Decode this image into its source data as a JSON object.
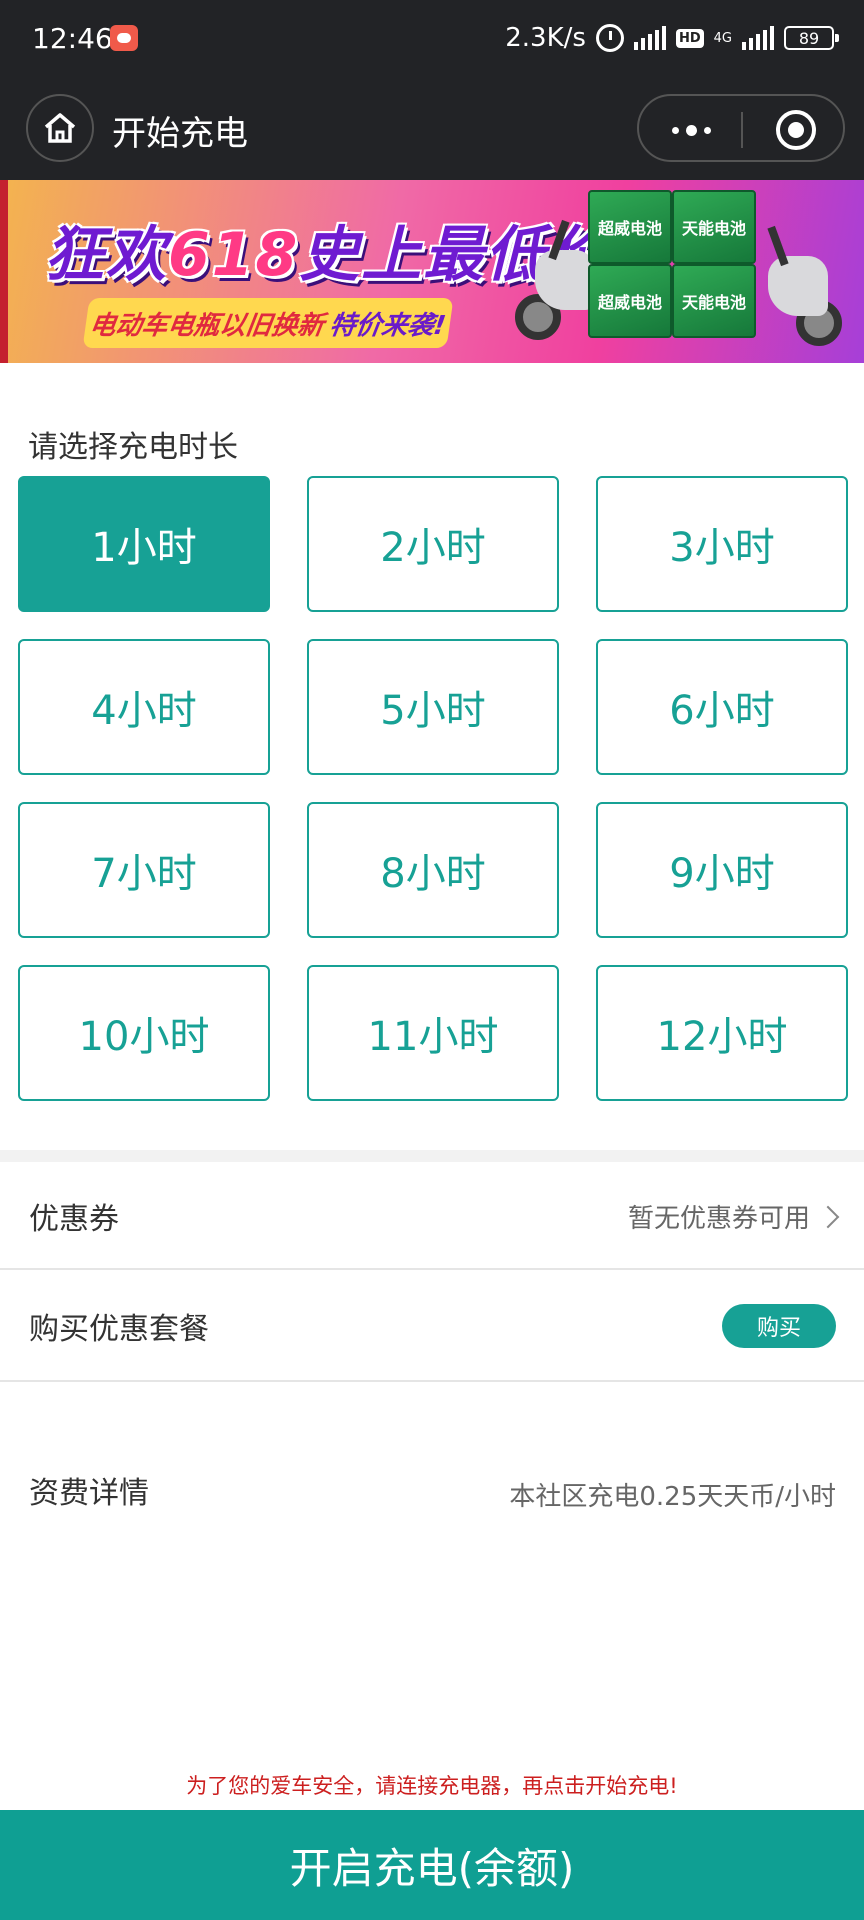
{
  "status_bar": {
    "time": "12:46",
    "network_speed": "2.3K/s",
    "hd": "HD",
    "net_type": "4G",
    "battery": "89"
  },
  "nav": {
    "title": "开始充电"
  },
  "banner": {
    "headline_a": "狂欢",
    "headline_num": "618",
    "headline_b": "史上最低价",
    "sub_a": "电动车电瓶以旧换新",
    "sub_b": "特价来袭!",
    "brand_1": "超威电池",
    "brand_2": "天能电池"
  },
  "duration": {
    "label": "请选择充电时长",
    "selected_index": 0,
    "options": [
      "1小时",
      "2小时",
      "3小时",
      "4小时",
      "5小时",
      "6小时",
      "7小时",
      "8小时",
      "9小时",
      "10小时",
      "11小时",
      "12小时"
    ]
  },
  "coupon": {
    "label": "优惠券",
    "value": "暂无优惠券可用"
  },
  "package": {
    "label": "购买优惠套餐",
    "button": "购买"
  },
  "tariff": {
    "label": "资费详情",
    "value": "本社区充电0.25天天币/小时"
  },
  "notice": "为了您的爱车安全，请连接充电器，再点击开始充电!",
  "start_button": "开启充电(余额)",
  "colors": {
    "accent": "#17a195",
    "nav_bg": "#222326",
    "notice": "#cc1f1f"
  }
}
